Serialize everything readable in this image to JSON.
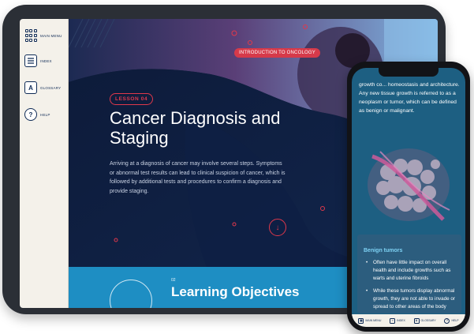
{
  "tablet": {
    "menu": {
      "items": [
        {
          "label": "MAIN MENU",
          "icon": "grid-icon"
        },
        {
          "label": "INDEX",
          "icon": "index-list-icon"
        },
        {
          "label": "GLOSSARY",
          "icon": "glossary-book-icon",
          "glyph": "A"
        },
        {
          "label": "HELP",
          "icon": "help-question-icon",
          "glyph": "?"
        }
      ]
    },
    "badge": "INTRODUCTION TO ONCOLOGY",
    "lesson": "LESSON 04",
    "title": "Cancer Diagnosis and Staging",
    "description": "Arriving at a diagnosis of cancer may involve several steps. Symptoms or abnormal test results can lead to clinical suspicion of cancer, which is followed by additional tests and procedures to confirm a diagnosis and provide staging.",
    "down_glyph": "↓",
    "objectives": {
      "number": "02",
      "title": "Learning Objectives"
    }
  },
  "phone": {
    "top_text": "growth co... homeostasis and architecture. Any new tissue growth is referred to as a neoplasm or tumor, which can be defined as benign or malignant.",
    "card": {
      "title": "Benign tumors",
      "bullets": [
        "Often have little impact on overall health and include growths such as warts and uterine fibroids",
        "While these tumors display abnormal growth, they are not able to invade or spread to other areas of the body"
      ]
    },
    "bottom_nav": [
      {
        "label": "MAIN MENU",
        "icon": "grid-icon"
      },
      {
        "label": "INDEX",
        "icon": "index-list-icon"
      },
      {
        "label": "GLOSSARY",
        "icon": "glossary-book-icon",
        "glyph": "A"
      },
      {
        "label": "HELP",
        "icon": "help-question-icon",
        "glyph": "?"
      }
    ]
  },
  "colors": {
    "accent_red": "#e0384b",
    "navy": "#0b1a36",
    "band_blue": "#1e8ec3",
    "menu_bg": "#f4f1ea"
  }
}
